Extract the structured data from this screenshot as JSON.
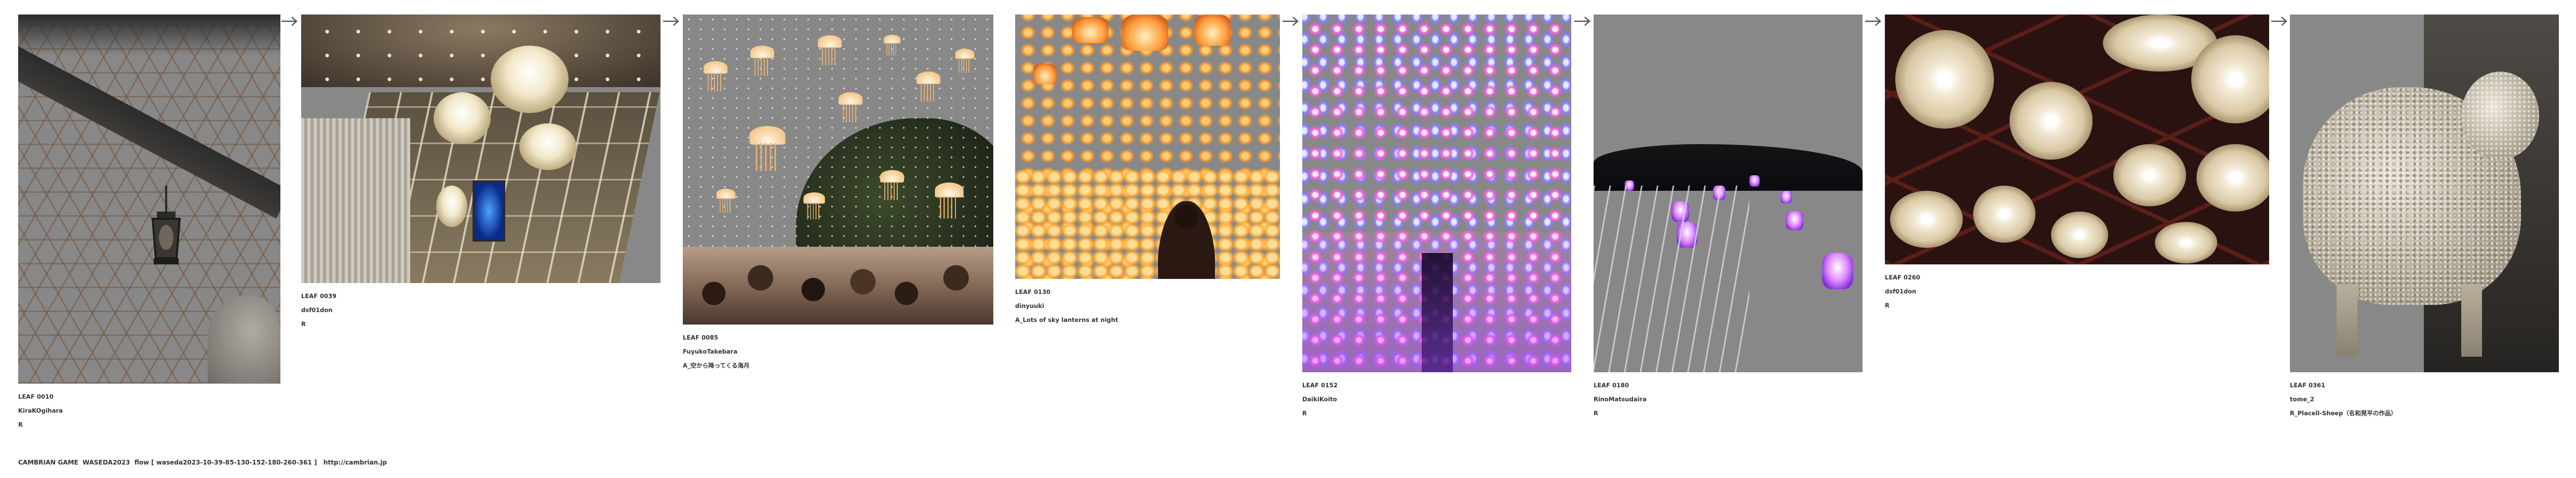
{
  "leaves": [
    {
      "id": "LEAF 0010",
      "author": "KiraKOgihara",
      "note": "R"
    },
    {
      "id": "LEAF 0039",
      "author": "dsf01don",
      "note": "R"
    },
    {
      "id": "LEAF 0085",
      "author": "FuyukoTakebara",
      "note": "A_空から降ってくる海月"
    },
    {
      "id": "LEAF 0130",
      "author": "dinyuuki",
      "note": "A_Lots of sky lanterns at night"
    },
    {
      "id": "LEAF 0152",
      "author": "DaikiKoito",
      "note": "R"
    },
    {
      "id": "LEAF 0180",
      "author": "RinoMatsudaira",
      "note": "R"
    },
    {
      "id": "LEAF 0260",
      "author": "dsf01don",
      "note": "R"
    },
    {
      "id": "LEAF 0361",
      "author": "tome_2",
      "note": "R_Placell-Sheep（名和晃平の作品）"
    }
  ],
  "images": [
    {
      "icon": "roller-coaster-lantern-photo"
    },
    {
      "icon": "chandelier-hall-photo"
    },
    {
      "icon": "jellyfish-sky-photo"
    },
    {
      "icon": "sky-lanterns-photo"
    },
    {
      "icon": "purple-lamps-photo"
    },
    {
      "icon": "night-lamps-railing-photo"
    },
    {
      "icon": "ceiling-lights-photo"
    },
    {
      "icon": "sheep-sculpture-photo"
    }
  ],
  "footer": {
    "text": "CAMBRIAN GAME  WASEDA2023  flow [ waseda2023-10-39-85-130-152-180-260-361 ]   http://cambrian.jp"
  },
  "colors": {
    "background": "#ffffff",
    "text": "#333333",
    "arrow": "#555555"
  }
}
